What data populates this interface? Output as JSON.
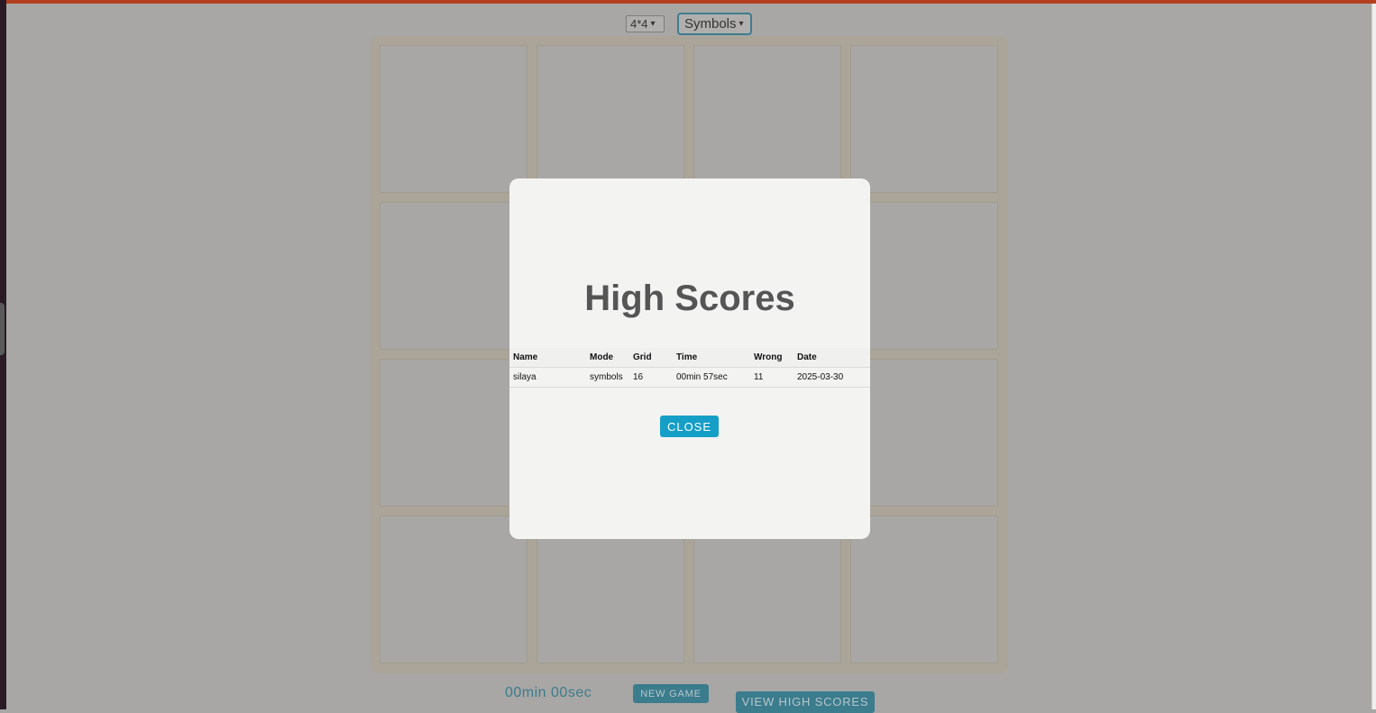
{
  "controls": {
    "grid_select_value": "4*4",
    "mode_select_value": "Symbols"
  },
  "board": {
    "rows": 4,
    "cols": 4
  },
  "footer": {
    "timer": "00min 00sec",
    "new_game_label": "NEW GAME",
    "view_high_scores_label": "VIEW HIGH SCORES"
  },
  "modal": {
    "title": "High Scores",
    "columns": [
      "Name",
      "Mode",
      "Grid",
      "Time",
      "Wrong",
      "Date"
    ],
    "rows": [
      [
        "silaya",
        "symbols",
        "16",
        "00min 57sec",
        "11",
        "2025-03-30"
      ]
    ],
    "close_label": "CLOSE"
  },
  "colors": {
    "accent": "#169fc6",
    "button_dim": "#3b7c8d",
    "top_bar": "#b3401f"
  }
}
